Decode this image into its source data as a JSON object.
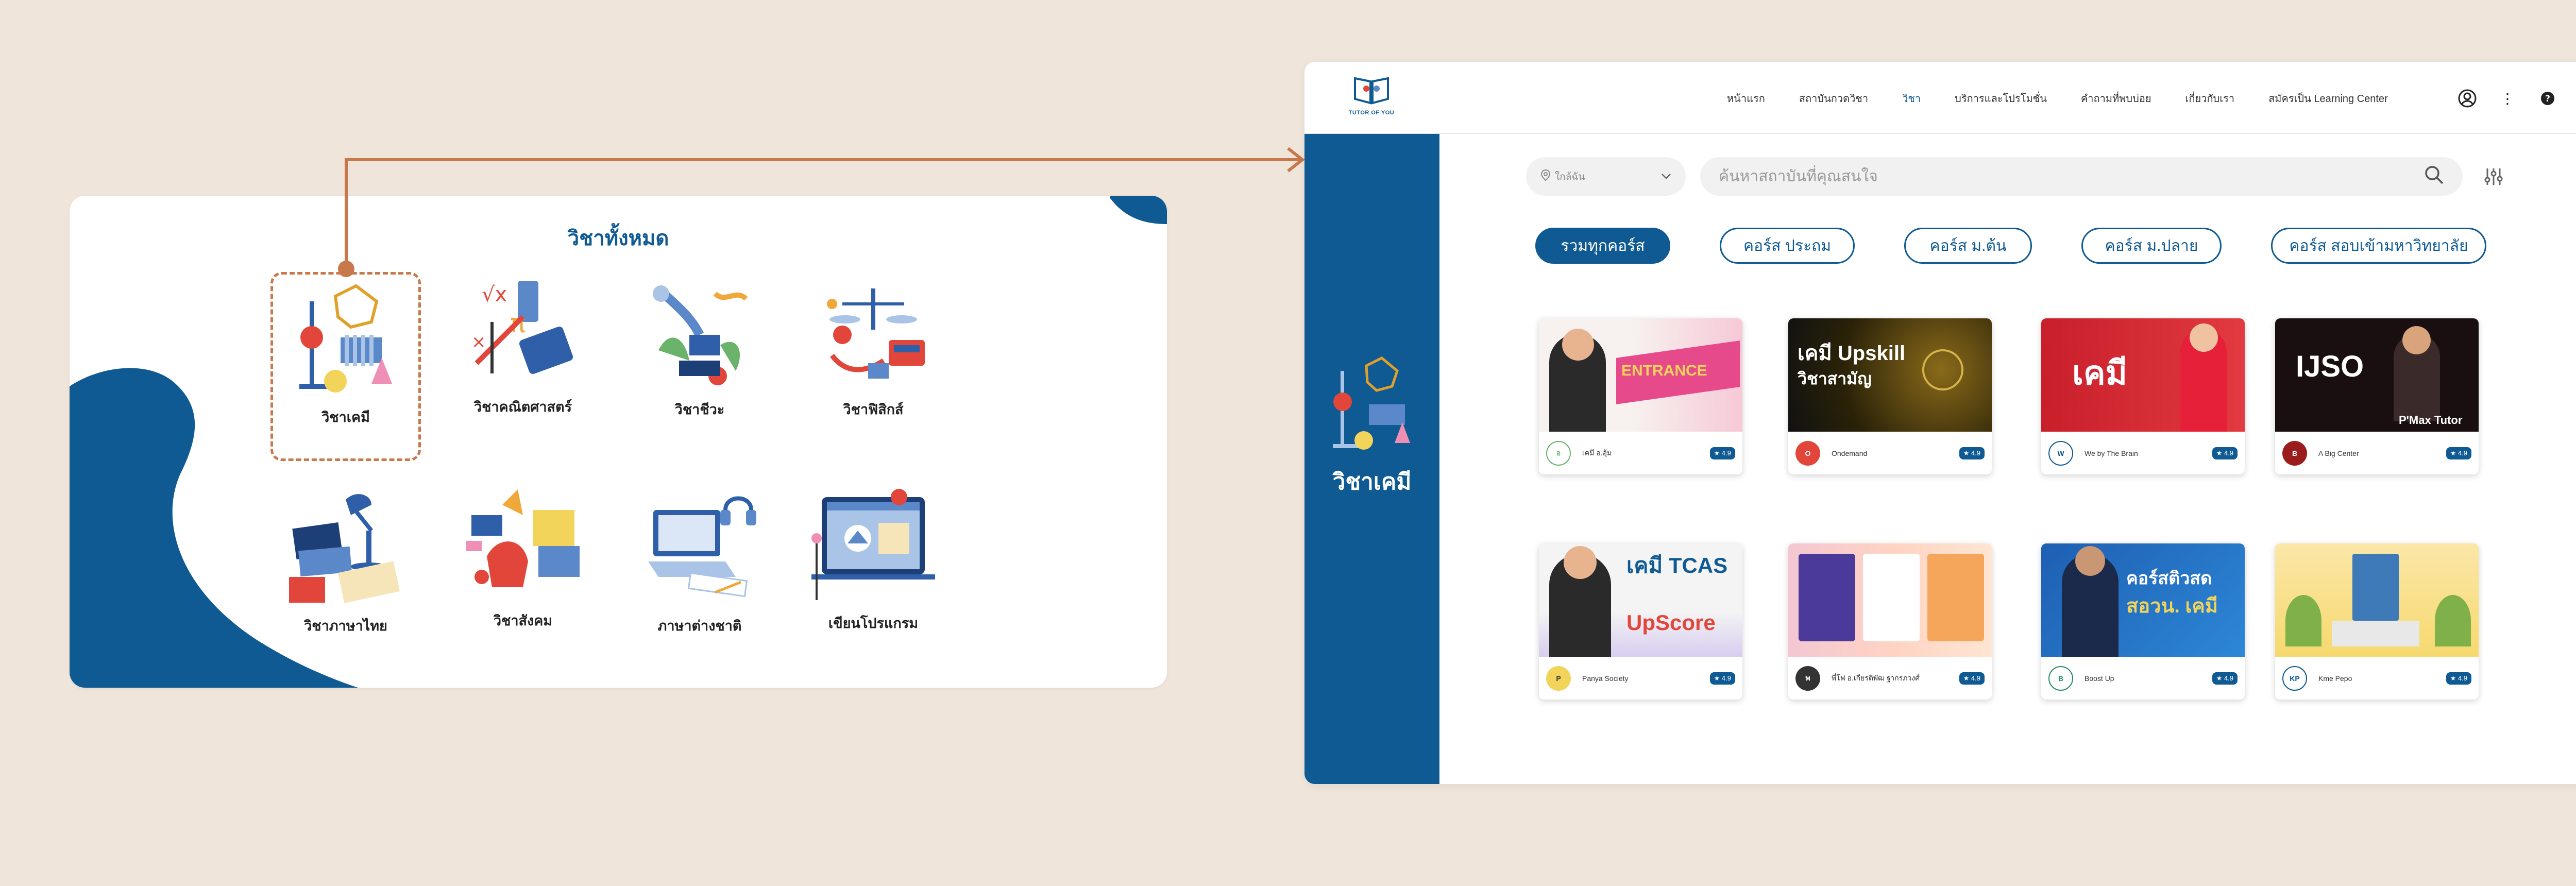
{
  "subjects_panel": {
    "title": "วิชาทั้งหมด",
    "items": [
      {
        "label": "วิชาเคมี",
        "icon": "chemistry-icon"
      },
      {
        "label": "วิชาคณิตศาสตร์",
        "icon": "math-icon"
      },
      {
        "label": "วิชาชีวะ",
        "icon": "biology-icon"
      },
      {
        "label": "วิชาฟิสิกส์",
        "icon": "physics-icon"
      },
      {
        "label": "วิชาภาษาไทย",
        "icon": "thai-language-icon"
      },
      {
        "label": "วิชาสังคม",
        "icon": "social-studies-icon"
      },
      {
        "label": "ภาษาต่างชาติ",
        "icon": "foreign-language-icon"
      },
      {
        "label": "เขียนโปรแกรม",
        "icon": "programming-icon"
      }
    ]
  },
  "header": {
    "logo_text": "TUTOR OF YOU",
    "nav": [
      {
        "label": "หน้าแรก"
      },
      {
        "label": "สถาบันกวดวิชา"
      },
      {
        "label": "วิชา",
        "active": true
      },
      {
        "label": "บริการและโปรโมชั่น"
      },
      {
        "label": "คำถามที่พบบ่อย"
      },
      {
        "label": "เกี่ยวกับเรา"
      },
      {
        "label": "สมัครเป็น Learning Center"
      }
    ],
    "icons": [
      "user-icon",
      "more-icon",
      "help-icon"
    ],
    "more_glyph": "⋮",
    "help_glyph": "?"
  },
  "sidebar": {
    "label": "วิชาเคมี"
  },
  "filters": {
    "location_value": "ใกล้ฉัน",
    "search_placeholder": "ค้นหาสถาบันที่คุณสนใจ"
  },
  "categories": [
    {
      "label": "รวมทุกคอร์ส",
      "active": true
    },
    {
      "label": "คอร์ส ประถม"
    },
    {
      "label": "คอร์ส ม.ต้น"
    },
    {
      "label": "คอร์ส ม.ปลาย"
    },
    {
      "label": "คอร์ส สอบเข้ามหาวิทยาลัย"
    }
  ],
  "courses": [
    {
      "thumb_text": "ENTRANCE",
      "provider": "เคมี อ.อุ้ม",
      "rating": "★ 4.9",
      "avatar": "อ"
    },
    {
      "thumb_text": "เคมี Upskill",
      "thumb_sub": "วิชาสามัญ",
      "provider": "Ondemand",
      "rating": "★ 4.9",
      "avatar": "O"
    },
    {
      "thumb_text": "เคมี",
      "provider": "We by The Brain",
      "rating": "★ 4.9",
      "avatar": "W"
    },
    {
      "thumb_text": "IJSO",
      "thumb_sub": "P'Max Tutor",
      "provider": "A Big Center",
      "rating": "★ 4.9",
      "avatar": "B"
    },
    {
      "thumb_text": "เคมี TCAS",
      "thumb_sub": "UpScore",
      "provider": "Panya Society",
      "rating": "★ 4.9",
      "avatar": "P"
    },
    {
      "thumb_text": "",
      "provider": "พี่โฟ อ.เกียรติพัฒ ฐากรภวงศ์",
      "rating": "★ 4.9",
      "avatar": "พ"
    },
    {
      "thumb_text": "คอร์สติวสด",
      "thumb_sub": "สอวน. เคมี",
      "provider": "Boost Up",
      "rating": "★ 4.9",
      "avatar": "B"
    },
    {
      "thumb_text": "",
      "provider": "Kme Pepo",
      "rating": "★ 4.9",
      "avatar": "KP"
    }
  ],
  "colors": {
    "primary": "#0f5a93",
    "background": "#efe5da",
    "accent": "#c8784a"
  }
}
